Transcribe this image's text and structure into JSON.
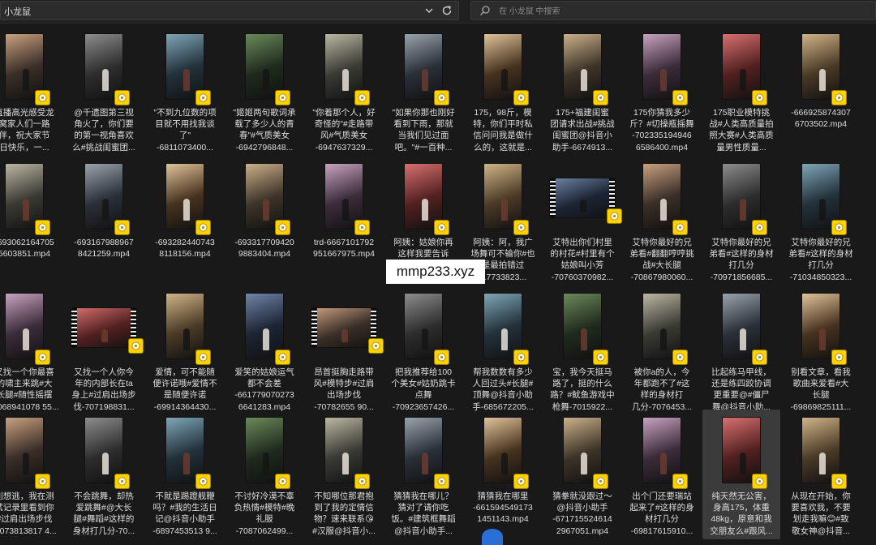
{
  "window": {
    "address_title": "小龙鼠",
    "search_placeholder": "在 小龙鼠 中搜索"
  },
  "watermark": "mmp233.xyz",
  "files": [
    {
      "label": "直播高光感受龙\n窝家人们一路\n伴，祝大家节\n日快乐，一..."
    },
    {
      "label": "@千遗图第三视\n角火了，你们要\n的第一视角喜欢\n么#挑战闺蜜团..."
    },
    {
      "label": "\"不到九位数的项\n目就不用找我谈\n了\"\n-6811073400..."
    },
    {
      "label": "\"姬姬两句歌词承\n载了多少人的青\n春\"#气质美女\n-6942796848..."
    },
    {
      "label": "\"你着那个人，好\n奇怪的\"#走路带\n风#气质美女\n-6947637329..."
    },
    {
      "label": "\"如果你那也刚好\n看到下雨，那就\n当我们见过面\n吧。\"#一百种..."
    },
    {
      "label": "175，98斤，模\n特，你们平时私\n信问问我是做什\n么的，这就是..."
    },
    {
      "label": "175+福建闺蜜\n团请求出战#挑战\n闺蜜团@抖音小\n助手-6674913..."
    },
    {
      "label": "175你猜我多少\n斤？#切操瓶摇舞\n-702335194946\n6586400.mp4"
    },
    {
      "label": "175职业模特挑\n战#人类高质量拍\n照大赛#人类高质\n量男性质量..."
    },
    {
      "label": "-666925874307\n6703502.mp4"
    },
    {
      "label": "-693062164705\n5603851.mp4"
    },
    {
      "label": "-693167988967\n8421259.mp4"
    },
    {
      "label": "-693282440743\n8118156.mp4"
    },
    {
      "label": "-693317709420\n9883404.mp4"
    },
    {
      "label": "trd-6667101792\n951667975.mp4"
    },
    {
      "label": "阿姨：姑娘你再\n这样我要告诉\n..."
    },
    {
      "label": "阿姨：阿，我广\n场舞可不输你#也\n是最拍错过\n...7733823..."
    },
    {
      "label": "艾特出你们村里\n的村花#村里有个\n姑娘叫小芳\n-70760370982..."
    },
    {
      "label": "艾特你最好的兄\n弟看#翻翻哼哼挑\n战#大长腿\n-70867980060..."
    },
    {
      "label": "艾特你最好的兄\n弟看#这样的身材\n打几分\n-70971856685..."
    },
    {
      "label": "艾特你最好的兄\n弟看#这样的身材\n打几分\n-71034850323..."
    },
    {
      "label": "又找一个你最喜\n的啸主来跳#大\n长腿#随性摇摆\n-7068941078 55..."
    },
    {
      "label": "又找一个人你今\n年的内部长在ta\n身上#过肩出场步\n伐-707198831..."
    },
    {
      "label": "爱情，可不能随\n便许诺哦#爱情不\n是随便许诺\n-69914364430..."
    },
    {
      "label": "爱笑的姑娘运气\n都不会差\n-661779070273\n6641283.mp4"
    },
    {
      "label": "昂首挺胸走路带\n风#模特步#过肩\n出场步伐\n-70782655 90..."
    },
    {
      "label": "把我推荐给100\n个美女#姑奶跳卡\n点舞\n-70923657426..."
    },
    {
      "label": "帮我数数有多少\n人回过头#长腿#\n顶舞@抖音小助\n手-685672205..."
    },
    {
      "label": "宝，我今天挺马\n路了，挺的什么\n路？#鱿鱼游戏中\n枪舞-7015922..."
    },
    {
      "label": "被你a的人，今\n年都跑不了#这\n样的身材打\n几分-7076453..."
    },
    {
      "label": "比起练马甲线，\n还是练四跤协调\n更重要@#僵尸\n舞@抖音小助..."
    },
    {
      "label": "别看文章，看我\n歌曲来爱看#大\n长腿\n-69869825111..."
    },
    {
      "label": "別想逃，我在测\n试记录里看到你\n#过肩出场步伐\n-7073813817 4..."
    },
    {
      "label": "不会跳舞，却热\n爱跳舞#@大长\n腿#舞蹈#这样的\n身材打几分-70..."
    },
    {
      "label": "不就是踢蹬舰鞭\n吗？#我的生活日\n记@抖音小助手\n-6897453513 9..."
    },
    {
      "label": "不讨好冷漠不辜\n负热情#模特#晚\n礼服\n-7087062499..."
    },
    {
      "label": "不知哪位那君抱\n到了我的定情信\n物？速来联系😘\n#汉服@抖音小..."
    },
    {
      "label": "猜猜我在哪儿？\n猜对了请你吃\n饭。#建筑框舞蹈\n@抖音小助手..."
    },
    {
      "label": "猜猜我在哪里\n-661594549173\n1451143.mp4"
    },
    {
      "label": "猜拳就没跟过～\n@抖音小助手\n-671715524614\n2967051.mp4"
    },
    {
      "label": "出个门还要瑞站\n起来了#这样的身\n材打几分\n-69817615910..."
    },
    {
      "label": "纯天然无公害，\n身高175，体重\n48kg，原意和我\n交朋友么#跟风..."
    },
    {
      "label": "从现在开始，你\n要喜欢我，不要\n划走我嘛😊#致\n敬女神@抖音..."
    }
  ]
}
